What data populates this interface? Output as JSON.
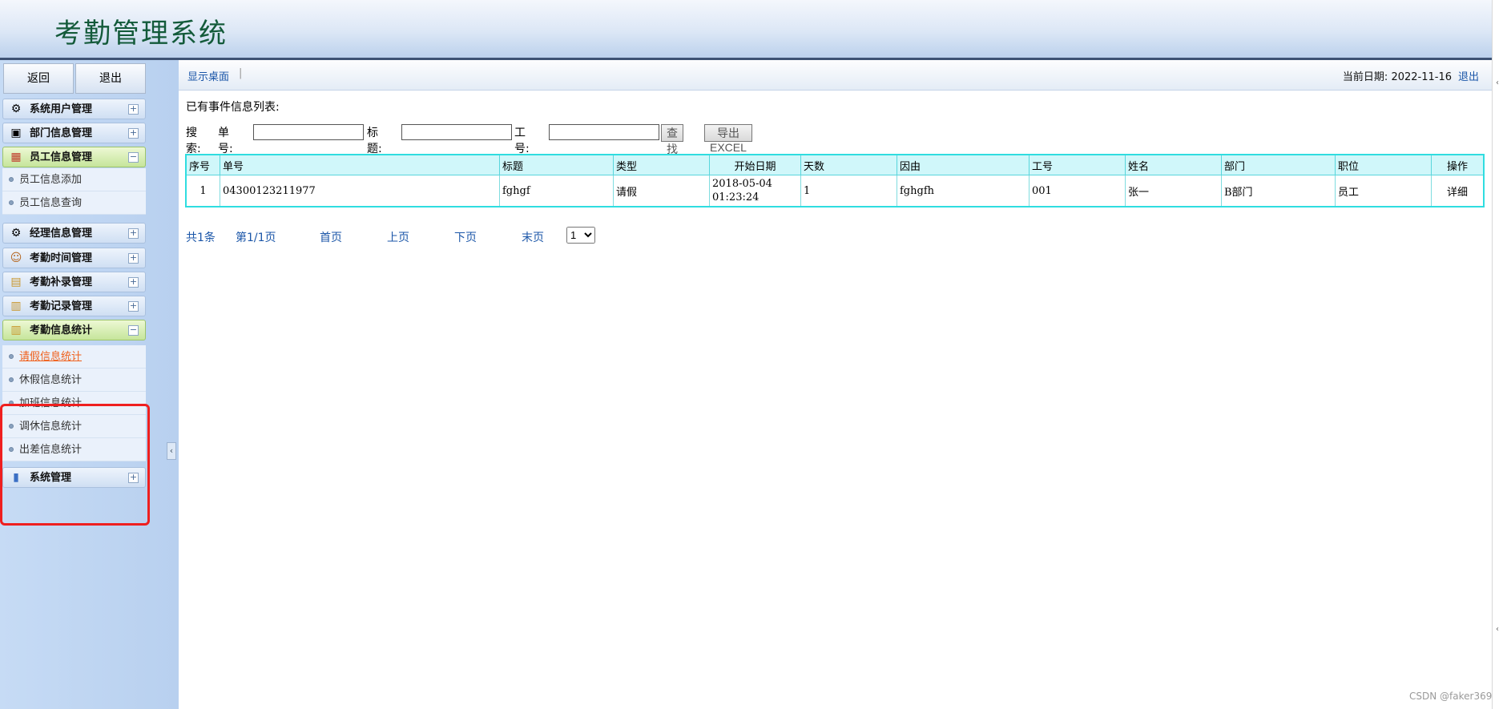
{
  "header": {
    "title": "考勤管理系统"
  },
  "sidebar": {
    "buttons": [
      "返回",
      "退出"
    ],
    "menus": [
      {
        "label": "系统用户管理",
        "icon": "gear-icon",
        "glyph": "⚙",
        "toggle": "+"
      },
      {
        "label": "部门信息管理",
        "icon": "monitor-icon",
        "glyph": "▣",
        "toggle": "+"
      },
      {
        "label": "员工信息管理",
        "icon": "calendar-icon",
        "glyph": "▦",
        "toggle": "−",
        "items": [
          "员工信息添加",
          "员工信息查询"
        ]
      },
      {
        "label": "经理信息管理",
        "icon": "gear-icon",
        "glyph": "⚙",
        "toggle": "+"
      },
      {
        "label": "考勤时间管理",
        "icon": "user-icon",
        "glyph": "☺",
        "toggle": "+"
      },
      {
        "label": "考勤补录管理",
        "icon": "folder-icon",
        "glyph": "▤",
        "toggle": "+"
      },
      {
        "label": "考勤记录管理",
        "icon": "clipboard-icon",
        "glyph": "▥",
        "toggle": "+"
      },
      {
        "label": "考勤信息统计",
        "icon": "clipboard-icon",
        "glyph": "▥",
        "toggle": "−",
        "items": [
          "请假信息统计",
          "休假信息统计",
          "加班信息统计",
          "调休信息统计",
          "出差信息统计"
        ]
      },
      {
        "label": "系统管理",
        "icon": "chart-icon",
        "glyph": "▮",
        "toggle": "+"
      }
    ]
  },
  "topbar": {
    "crumb": "显示桌面",
    "date_label": "当前日期:",
    "date": "2022-11-16",
    "logout": "退出"
  },
  "main": {
    "list_title": "已有事件信息列表:",
    "search": {
      "label": "搜索:",
      "order_label": "单号:",
      "title_label": "标题:",
      "staff_label": "工号:",
      "find": "查找",
      "export": "导出EXCEL"
    },
    "table": {
      "headers": [
        "序号",
        "单号",
        "标题",
        "类型",
        "开始日期",
        "天数",
        "因由",
        "工号",
        "姓名",
        "部门",
        "职位",
        "操作"
      ],
      "rows": [
        [
          "1",
          "04300123211977",
          "fghgf",
          "请假",
          "2018-05-04 01:23:24",
          "1",
          "fghgfh",
          "001",
          "张一",
          "B部门",
          "员工",
          "详细"
        ]
      ]
    },
    "pager": {
      "total": "共1条",
      "page": "第1/1页",
      "first": "首页",
      "prev": "上页",
      "next": "下页",
      "last": "末页",
      "selected": "1"
    }
  },
  "watermark": "CSDN @faker369"
}
